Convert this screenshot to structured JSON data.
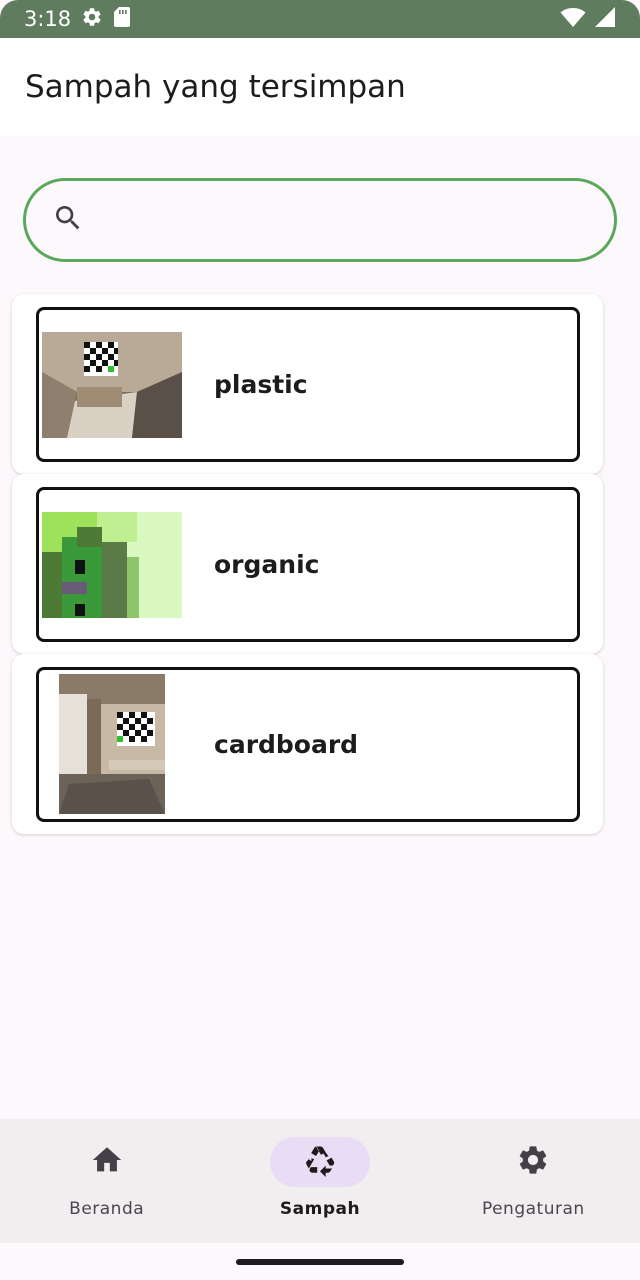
{
  "status_bar": {
    "time": "3:18",
    "icons_left": [
      "settings-icon",
      "sd-card-icon"
    ],
    "icons_right": [
      "wifi-icon",
      "signal-icon"
    ]
  },
  "app_bar": {
    "title": "Sampah yang tersimpan"
  },
  "search": {
    "value": "",
    "placeholder": ""
  },
  "items": [
    {
      "label": "plastic"
    },
    {
      "label": "organic"
    },
    {
      "label": "cardboard"
    }
  ],
  "bottom_nav": {
    "items": [
      {
        "label": "Beranda",
        "icon": "home-icon",
        "active": false
      },
      {
        "label": "Sampah",
        "icon": "recycle-icon",
        "active": true
      },
      {
        "label": "Pengaturan",
        "icon": "gear-icon",
        "active": false
      }
    ]
  },
  "colors": {
    "status_bar": "#5f7d5e",
    "search_border": "#5aa85a",
    "active_pill": "#e8ddf4"
  }
}
